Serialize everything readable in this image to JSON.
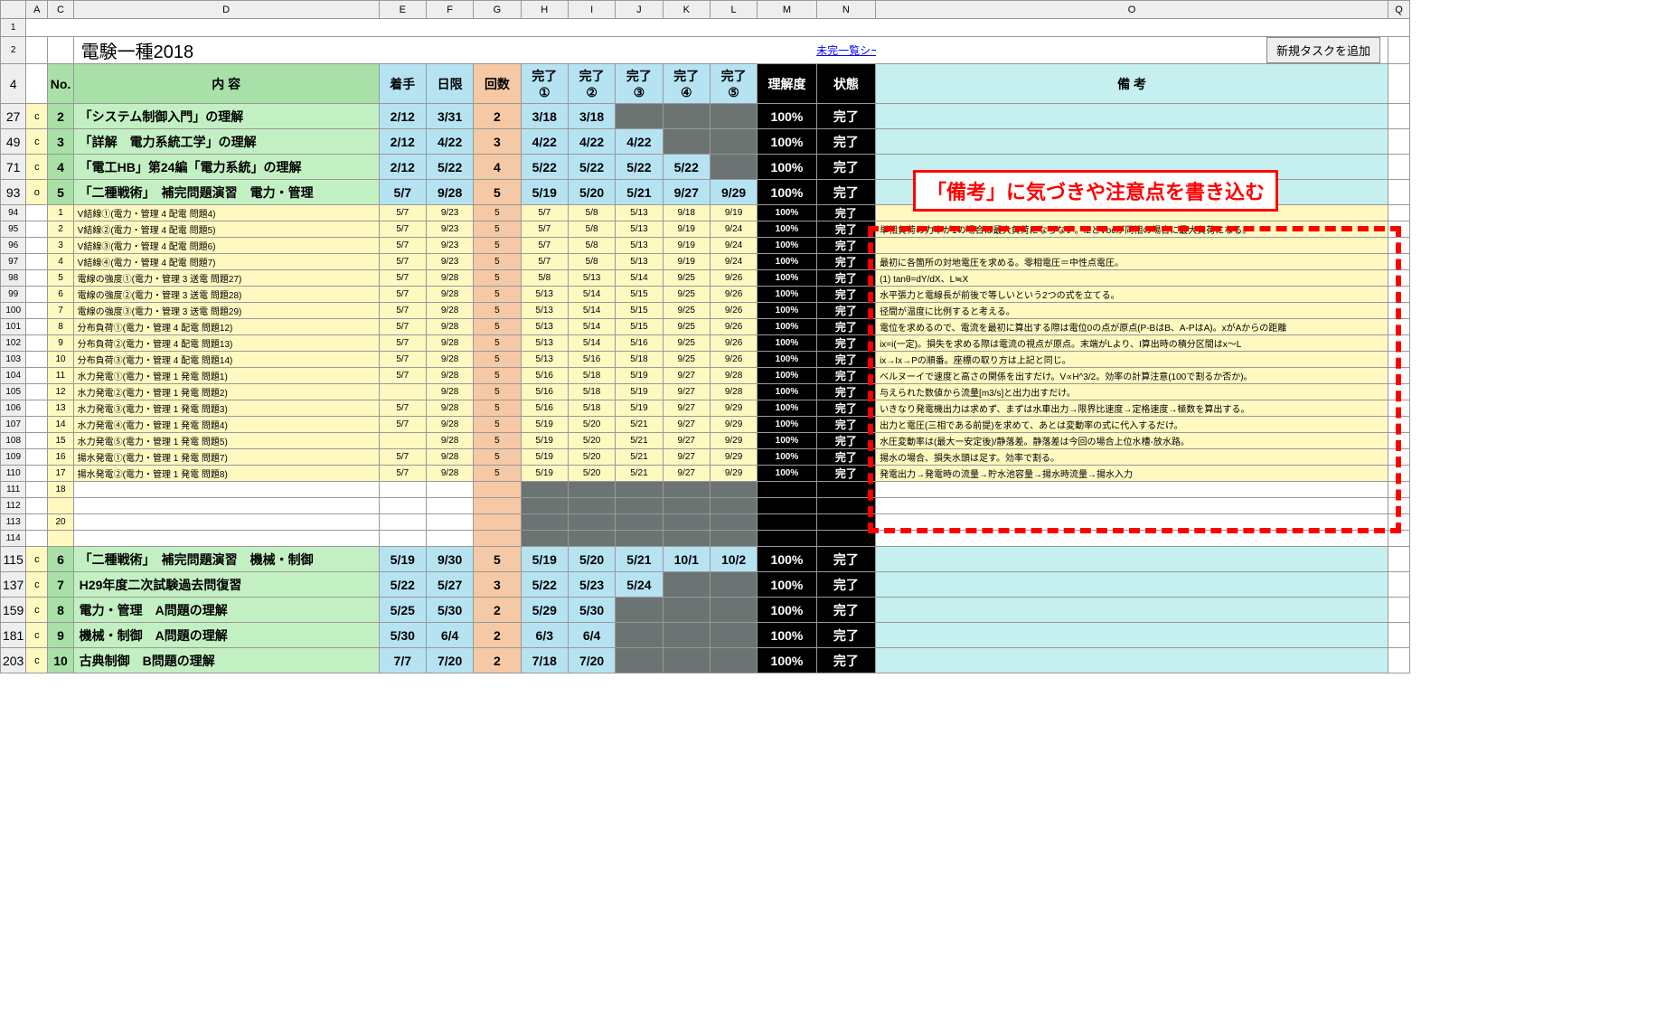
{
  "title": "電験一種2018",
  "link_text": "未完一覧シートへ",
  "button_text": "新規タスクを追加",
  "annotation": "「備考」に気づきや注意点を書き込む",
  "col_letters": [
    "",
    "A",
    "C",
    "D",
    "E",
    "F",
    "G",
    "H",
    "I",
    "J",
    "K",
    "L",
    "M",
    "N",
    "O",
    "Q"
  ],
  "headers": {
    "no": "No.",
    "naiyou": "内 容",
    "chakushu": "着手",
    "kigen": "日限",
    "kaisuu": "回数",
    "kanryou": [
      "完了\n①",
      "完了\n②",
      "完了\n③",
      "完了\n④",
      "完了\n⑤"
    ],
    "rikai": "理解度",
    "joutai": "状態",
    "bikou": "備 考"
  },
  "row_numbers_top": [
    "1",
    "2",
    "4"
  ],
  "majors": [
    {
      "row": "27",
      "mark": "c",
      "no": "2",
      "desc": "「システム制御入門」の理解",
      "s": "2/12",
      "e": "3/31",
      "cnt": "2",
      "done": [
        "3/18",
        "3/18",
        "",
        "",
        ""
      ],
      "pct": "100%",
      "state": "完了",
      "note": ""
    },
    {
      "row": "49",
      "mark": "c",
      "no": "3",
      "desc": "「詳解　電力系統工学」の理解",
      "s": "2/12",
      "e": "4/22",
      "cnt": "3",
      "done": [
        "4/22",
        "4/22",
        "4/22",
        "",
        ""
      ],
      "pct": "100%",
      "state": "完了",
      "note": ""
    },
    {
      "row": "71",
      "mark": "c",
      "no": "4",
      "desc": "「電工HB」第24編「電力系統」の理解",
      "s": "2/12",
      "e": "5/22",
      "cnt": "4",
      "done": [
        "5/22",
        "5/22",
        "5/22",
        "5/22",
        ""
      ],
      "pct": "100%",
      "state": "完了",
      "note": ""
    },
    {
      "row": "93",
      "mark": "o",
      "no": "5",
      "desc": "「二種戦術」　補完問題演習　電力・管理",
      "s": "5/7",
      "e": "9/28",
      "cnt": "5",
      "done": [
        "5/19",
        "5/20",
        "5/21",
        "9/27",
        "9/29"
      ],
      "pct": "100%",
      "state": "完了",
      "note": ""
    }
  ],
  "subs": [
    {
      "row": "94",
      "no": "1",
      "desc": "V結線①(電力・管理  4 配電  問題4)",
      "s": "5/7",
      "e": "9/23",
      "cnt": "5",
      "done": [
        "5/7",
        "5/8",
        "5/13",
        "9/18",
        "9/19"
      ],
      "pct": "100%",
      "state": "完了",
      "note": ""
    },
    {
      "row": "95",
      "no": "2",
      "desc": "V結線②(電力・管理  4 配電  問題5)",
      "s": "5/7",
      "e": "9/23",
      "cnt": "5",
      "done": [
        "5/7",
        "5/8",
        "5/13",
        "9/19",
        "9/24"
      ],
      "pct": "100%",
      "state": "完了",
      "note": "単相負荷の力率が1の場合は最大負荷にならない。I2とVbcが同相の場合に最大負荷になる。"
    },
    {
      "row": "96",
      "no": "3",
      "desc": "V結線③(電力・管理  4 配電  問題6)",
      "s": "5/7",
      "e": "9/23",
      "cnt": "5",
      "done": [
        "5/7",
        "5/8",
        "5/13",
        "9/19",
        "9/24"
      ],
      "pct": "100%",
      "state": "完了",
      "note": ""
    },
    {
      "row": "97",
      "no": "4",
      "desc": "V結線④(電力・管理  4 配電  問題7)",
      "s": "5/7",
      "e": "9/23",
      "cnt": "5",
      "done": [
        "5/7",
        "5/8",
        "5/13",
        "9/19",
        "9/24"
      ],
      "pct": "100%",
      "state": "完了",
      "note": "最初に各箇所の対地電圧を求める。零相電圧＝中性点電圧。"
    },
    {
      "row": "98",
      "no": "5",
      "desc": "電線の強度①(電力・管理  3 送電  問題27)",
      "s": "5/7",
      "e": "9/28",
      "cnt": "5",
      "done": [
        "5/8",
        "5/13",
        "5/14",
        "9/25",
        "9/26"
      ],
      "pct": "100%",
      "state": "完了",
      "note": "(1) tanθ=dY/dX、L≒X"
    },
    {
      "row": "99",
      "no": "6",
      "desc": "電線の強度②(電力・管理  3 送電  問題28)",
      "s": "5/7",
      "e": "9/28",
      "cnt": "5",
      "done": [
        "5/13",
        "5/14",
        "5/15",
        "9/25",
        "9/26"
      ],
      "pct": "100%",
      "state": "完了",
      "note": "水平張力と電線長が前後で等しいという2つの式を立てる。"
    },
    {
      "row": "100",
      "no": "7",
      "desc": "電線の強度③(電力・管理  3 送電  問題29)",
      "s": "5/7",
      "e": "9/28",
      "cnt": "5",
      "done": [
        "5/13",
        "5/14",
        "5/15",
        "9/25",
        "9/26"
      ],
      "pct": "100%",
      "state": "完了",
      "note": "径間が温度に比例すると考える。"
    },
    {
      "row": "101",
      "no": "8",
      "desc": "分布負荷①(電力・管理  4 配電  問題12)",
      "s": "5/7",
      "e": "9/28",
      "cnt": "5",
      "done": [
        "5/13",
        "5/14",
        "5/15",
        "9/25",
        "9/26"
      ],
      "pct": "100%",
      "state": "完了",
      "note": "電位を求めるので、電流を最初に算出する際は電位0の点が原点(P-BはB、A-PはA)。xがAからの距離"
    },
    {
      "row": "102",
      "no": "9",
      "desc": "分布負荷②(電力・管理  4 配電  問題13)",
      "s": "5/7",
      "e": "9/28",
      "cnt": "5",
      "done": [
        "5/13",
        "5/14",
        "5/16",
        "9/25",
        "9/26"
      ],
      "pct": "100%",
      "state": "完了",
      "note": "ix=i(一定)。損失を求める際は電流の視点が原点。末端がLより、I算出時の積分区間はx～L"
    },
    {
      "row": "103",
      "no": "10",
      "desc": "分布負荷③(電力・管理  4 配電  問題14)",
      "s": "5/7",
      "e": "9/28",
      "cnt": "5",
      "done": [
        "5/13",
        "5/16",
        "5/18",
        "9/25",
        "9/26"
      ],
      "pct": "100%",
      "state": "完了",
      "note": "ix→Ix→Pの順番。座標の取り方は上記と同じ。"
    },
    {
      "row": "104",
      "no": "11",
      "desc": "水力発電①(電力・管理  1 発電  問題1)",
      "s": "5/7",
      "e": "9/28",
      "cnt": "5",
      "done": [
        "5/16",
        "5/18",
        "5/19",
        "9/27",
        "9/28"
      ],
      "pct": "100%",
      "state": "完了",
      "note": "ベルヌーイで速度と高さの関係を出すだけ。V∝H^3/2。効率の計算注意(100で割るか否か)。"
    },
    {
      "row": "105",
      "no": "12",
      "desc": "水力発電②(電力・管理  1 発電  問題2)",
      "s": "",
      "e": "9/28",
      "cnt": "5",
      "done": [
        "5/16",
        "5/18",
        "5/19",
        "9/27",
        "9/28"
      ],
      "pct": "100%",
      "state": "完了",
      "note": "与えられた数値から流量[m3/s]と出力出すだけ。"
    },
    {
      "row": "106",
      "no": "13",
      "desc": "水力発電③(電力・管理  1 発電  問題3)",
      "s": "5/7",
      "e": "9/28",
      "cnt": "5",
      "done": [
        "5/16",
        "5/18",
        "5/19",
        "9/27",
        "9/29"
      ],
      "pct": "100%",
      "state": "完了",
      "note": "いきなり発電機出力は求めず、まずは水車出力→限界比速度→定格速度→極数を算出する。"
    },
    {
      "row": "107",
      "no": "14",
      "desc": "水力発電④(電力・管理  1 発電  問題4)",
      "s": "5/7",
      "e": "9/28",
      "cnt": "5",
      "done": [
        "5/19",
        "5/20",
        "5/21",
        "9/27",
        "9/29"
      ],
      "pct": "100%",
      "state": "完了",
      "note": "出力と電圧(三相である前提)を求めて、あとは変動率の式に代入するだけ。"
    },
    {
      "row": "108",
      "no": "15",
      "desc": "水力発電⑤(電力・管理  1 発電  問題5)",
      "s": "",
      "e": "9/28",
      "cnt": "5",
      "done": [
        "5/19",
        "5/20",
        "5/21",
        "9/27",
        "9/29"
      ],
      "pct": "100%",
      "state": "完了",
      "note": "水圧変動率は(最大ー安定後)/静落差。静落差は今回の場合上位水槽-放水路。"
    },
    {
      "row": "109",
      "no": "16",
      "desc": "揚水発電①(電力・管理  1 発電  問題7)",
      "s": "5/7",
      "e": "9/28",
      "cnt": "5",
      "done": [
        "5/19",
        "5/20",
        "5/21",
        "9/27",
        "9/29"
      ],
      "pct": "100%",
      "state": "完了",
      "note": "揚水の場合、損失水頭は足す。効率で割る。"
    },
    {
      "row": "110",
      "no": "17",
      "desc": "揚水発電②(電力・管理  1 発電  問題8)",
      "s": "5/7",
      "e": "9/28",
      "cnt": "5",
      "done": [
        "5/19",
        "5/20",
        "5/21",
        "9/27",
        "9/29"
      ],
      "pct": "100%",
      "state": "完了",
      "note": "発電出力→発電時の流量→貯水池容量→揚水時流量→揚水入力"
    }
  ],
  "empty_subs": [
    {
      "row": "111",
      "no": "18"
    },
    {
      "row": "112",
      "no": ""
    },
    {
      "row": "113",
      "no": "20"
    },
    {
      "row": "114",
      "no": ""
    }
  ],
  "majors2": [
    {
      "row": "115",
      "mark": "c",
      "no": "6",
      "desc": "「二種戦術」　補完問題演習　機械・制御",
      "s": "5/19",
      "e": "9/30",
      "cnt": "5",
      "done": [
        "5/19",
        "5/20",
        "5/21",
        "10/1",
        "10/2"
      ],
      "pct": "100%",
      "state": "完了",
      "note": ""
    },
    {
      "row": "137",
      "mark": "c",
      "no": "7",
      "desc": "H29年度二次試験過去問復習",
      "s": "5/22",
      "e": "5/27",
      "cnt": "3",
      "done": [
        "5/22",
        "5/23",
        "5/24",
        "",
        ""
      ],
      "pct": "100%",
      "state": "完了",
      "note": ""
    },
    {
      "row": "159",
      "mark": "c",
      "no": "8",
      "desc": "電力・管理　A問題の理解",
      "s": "5/25",
      "e": "5/30",
      "cnt": "2",
      "done": [
        "5/29",
        "5/30",
        "",
        "",
        ""
      ],
      "pct": "100%",
      "state": "完了",
      "note": ""
    },
    {
      "row": "181",
      "mark": "c",
      "no": "9",
      "desc": "機械・制御　A問題の理解",
      "s": "5/30",
      "e": "6/4",
      "cnt": "2",
      "done": [
        "6/3",
        "6/4",
        "",
        "",
        ""
      ],
      "pct": "100%",
      "state": "完了",
      "note": ""
    },
    {
      "row": "203",
      "mark": "c",
      "no": "10",
      "desc": "古典制御　B問題の理解",
      "s": "7/7",
      "e": "7/20",
      "cnt": "2",
      "done": [
        "7/18",
        "7/20",
        "",
        "",
        ""
      ],
      "pct": "100%",
      "state": "完了",
      "note": ""
    }
  ]
}
